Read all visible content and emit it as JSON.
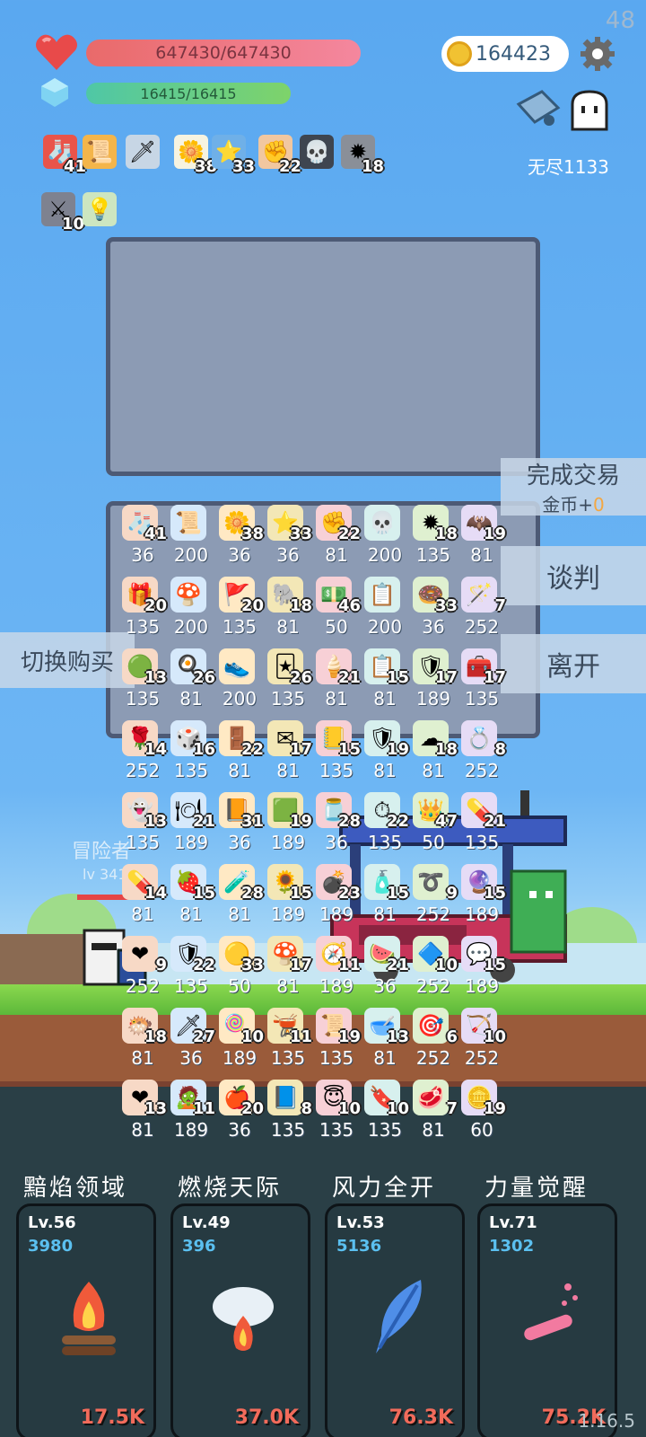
{
  "fps": "48",
  "version": "1.16.5",
  "hud": {
    "hp": "647430/647430",
    "mp": "16415/16415",
    "gold": "164423",
    "endless": "无尽1133"
  },
  "buffs": [
    {
      "icon": "sock-icon",
      "glyph": "🧦",
      "count": "41"
    },
    {
      "icon": "menu-icon",
      "glyph": "📜",
      "count": ""
    },
    {
      "icon": "sword-icon",
      "glyph": "🗡",
      "count": ""
    },
    {
      "icon": "flower-icon",
      "glyph": "🌼",
      "count": "38"
    },
    {
      "icon": "star-card-icon",
      "glyph": "⭐",
      "count": "33"
    },
    {
      "icon": "fist-icon",
      "glyph": "✊",
      "count": "22"
    },
    {
      "icon": "skull-book-icon",
      "glyph": "💀",
      "count": ""
    },
    {
      "icon": "spike-ball-icon",
      "glyph": "✹",
      "count": "18"
    },
    {
      "icon": "sword-card-icon",
      "glyph": "⚔",
      "count": "10"
    },
    {
      "icon": "bulb-card-icon",
      "glyph": "💡",
      "count": ""
    }
  ],
  "buttons": {
    "deal": "完成交易",
    "deal_gold_label": "金币+",
    "deal_gold_value": "0",
    "negotiate": "谈判",
    "leave": "离开",
    "switch": "切换购买"
  },
  "adventurer": {
    "name": "冒险者",
    "level": "lv 341"
  },
  "items": [
    {
      "icon": "sock-icon",
      "glyph": "🧦",
      "count": "41",
      "price": "36"
    },
    {
      "icon": "menu-icon",
      "glyph": "📜",
      "count": "",
      "price": "200"
    },
    {
      "icon": "flower-icon",
      "glyph": "🌼",
      "count": "38",
      "price": "36"
    },
    {
      "icon": "star-card-icon",
      "glyph": "⭐",
      "count": "33",
      "price": "36"
    },
    {
      "icon": "fist-icon",
      "glyph": "✊",
      "count": "22",
      "price": "81"
    },
    {
      "icon": "skull-book-icon",
      "glyph": "💀",
      "count": "",
      "price": "200"
    },
    {
      "icon": "spike-ball-icon",
      "glyph": "✹",
      "count": "18",
      "price": "135"
    },
    {
      "icon": "bat-icon",
      "glyph": "🦇",
      "count": "19",
      "price": "81"
    },
    {
      "icon": "gift-icon",
      "glyph": "🎁",
      "count": "20",
      "price": "135"
    },
    {
      "icon": "mushroom-icon",
      "glyph": "🍄",
      "count": "",
      "price": "200"
    },
    {
      "icon": "flag-icon",
      "glyph": "🚩",
      "count": "20",
      "price": "135"
    },
    {
      "icon": "elephant-icon",
      "glyph": "🐘",
      "count": "18",
      "price": "81"
    },
    {
      "icon": "cash-heart-icon",
      "glyph": "💵",
      "count": "46",
      "price": "50"
    },
    {
      "icon": "list-icon",
      "glyph": "📋",
      "count": "",
      "price": "200"
    },
    {
      "icon": "donut-icon",
      "glyph": "🍩",
      "count": "33",
      "price": "36"
    },
    {
      "icon": "wand-icon",
      "glyph": "🪄",
      "count": "7",
      "price": "252"
    },
    {
      "icon": "leaf-ball-icon",
      "glyph": "🟢",
      "count": "13",
      "price": "135"
    },
    {
      "icon": "egg-icon",
      "glyph": "🍳",
      "count": "26",
      "price": "81"
    },
    {
      "icon": "sneaker-icon",
      "glyph": "👟",
      "count": "",
      "price": "200"
    },
    {
      "icon": "cards-icon",
      "glyph": "🃏",
      "count": "26",
      "price": "135"
    },
    {
      "icon": "ice-cream-icon",
      "glyph": "🍦",
      "count": "21",
      "price": "81"
    },
    {
      "icon": "clipboard-icon",
      "glyph": "📋",
      "count": "15",
      "price": "81"
    },
    {
      "icon": "shield-icon",
      "glyph": "🛡",
      "count": "17",
      "price": "189"
    },
    {
      "icon": "chest-icon",
      "glyph": "🧰",
      "count": "17",
      "price": "135"
    },
    {
      "icon": "rose-icon",
      "glyph": "🌹",
      "count": "14",
      "price": "252"
    },
    {
      "icon": "dice-icon",
      "glyph": "🎲",
      "count": "16",
      "price": "135"
    },
    {
      "icon": "door-icon",
      "glyph": "🚪",
      "count": "22",
      "price": "81"
    },
    {
      "icon": "envelope-icon",
      "glyph": "✉",
      "count": "17",
      "price": "81"
    },
    {
      "icon": "notebook-icon",
      "glyph": "📒",
      "count": "15",
      "price": "135"
    },
    {
      "icon": "shield-blue-icon",
      "glyph": "🛡",
      "count": "19",
      "price": "81"
    },
    {
      "icon": "cloud-icon",
      "glyph": "☁",
      "count": "18",
      "price": "81"
    },
    {
      "icon": "ring-icon",
      "glyph": "💍",
      "count": "8",
      "price": "252"
    },
    {
      "icon": "ghost-icon",
      "glyph": "👻",
      "count": "13",
      "price": "135"
    },
    {
      "icon": "plate-icon",
      "glyph": "🍽",
      "count": "21",
      "price": "189"
    },
    {
      "icon": "book-icon",
      "glyph": "📙",
      "count": "31",
      "price": "36"
    },
    {
      "icon": "slime-icon",
      "glyph": "🟩",
      "count": "19",
      "price": "189"
    },
    {
      "icon": "jar-icon",
      "glyph": "🫙",
      "count": "28",
      "price": "36"
    },
    {
      "icon": "stopwatch-icon",
      "glyph": "⏱",
      "count": "22",
      "price": "135"
    },
    {
      "icon": "crown-icon",
      "glyph": "👑",
      "count": "47",
      "price": "50"
    },
    {
      "icon": "pill-icon",
      "glyph": "💊",
      "count": "21",
      "price": "135"
    },
    {
      "icon": "capsule-icon",
      "glyph": "💊",
      "count": "14",
      "price": "81"
    },
    {
      "icon": "strawberry-icon",
      "glyph": "🍓",
      "count": "15",
      "price": "81"
    },
    {
      "icon": "potion-icon",
      "glyph": "🧪",
      "count": "28",
      "price": "81"
    },
    {
      "icon": "sunflower-icon",
      "glyph": "🌻",
      "count": "15",
      "price": "189"
    },
    {
      "icon": "grenade-icon",
      "glyph": "💣",
      "count": "23",
      "price": "189"
    },
    {
      "icon": "spray-icon",
      "glyph": "🧴",
      "count": "15",
      "price": "81"
    },
    {
      "icon": "noose-icon",
      "glyph": "➰",
      "count": "9",
      "price": "252"
    },
    {
      "icon": "orb-icon",
      "glyph": "🔮",
      "count": "15",
      "price": "189"
    },
    {
      "icon": "heart-gem-icon",
      "glyph": "❤",
      "count": "9",
      "price": "252"
    },
    {
      "icon": "star-shield-icon",
      "glyph": "🛡",
      "count": "22",
      "price": "135"
    },
    {
      "icon": "egg-yolk-icon",
      "glyph": "🟡",
      "count": "33",
      "price": "50"
    },
    {
      "icon": "toadstool-icon",
      "glyph": "🍄",
      "count": "17",
      "price": "81"
    },
    {
      "icon": "compass-icon",
      "glyph": "🧭",
      "count": "11",
      "price": "189"
    },
    {
      "icon": "watermelon-icon",
      "glyph": "🍉",
      "count": "21",
      "price": "36"
    },
    {
      "icon": "hexagon-gem-icon",
      "glyph": "🔷",
      "count": "10",
      "price": "252"
    },
    {
      "icon": "speech-bubble-icon",
      "glyph": "💬",
      "count": "15",
      "price": "189"
    },
    {
      "icon": "bubble-fish-icon",
      "glyph": "🐡",
      "count": "18",
      "price": "81"
    },
    {
      "icon": "dagger-icon",
      "glyph": "🗡",
      "count": "27",
      "price": "36"
    },
    {
      "icon": "lollipop-icon",
      "glyph": "🍭",
      "count": "10",
      "price": "189"
    },
    {
      "icon": "cauldron-icon",
      "glyph": "🫕",
      "count": "11",
      "price": "135"
    },
    {
      "icon": "scroll-icon",
      "glyph": "📜",
      "count": "19",
      "price": "135"
    },
    {
      "icon": "bowl-icon",
      "glyph": "🥣",
      "count": "13",
      "price": "81"
    },
    {
      "icon": "target-icon",
      "glyph": "🎯",
      "count": "6",
      "price": "252"
    },
    {
      "icon": "crossbow-icon",
      "glyph": "🏹",
      "count": "10",
      "price": "252"
    },
    {
      "icon": "big-heart-icon",
      "glyph": "❤",
      "count": "13",
      "price": "81"
    },
    {
      "icon": "zombie-icon",
      "glyph": "🧟",
      "count": "11",
      "price": "189"
    },
    {
      "icon": "apple-icon",
      "glyph": "🍎",
      "count": "20",
      "price": "36"
    },
    {
      "icon": "blue-scroll-icon",
      "glyph": "📘",
      "count": "8",
      "price": "135"
    },
    {
      "icon": "halo-icon",
      "glyph": "😇",
      "count": "10",
      "price": "135"
    },
    {
      "icon": "red-banner-icon",
      "glyph": "🔖",
      "count": "10",
      "price": "135"
    },
    {
      "icon": "meat-icon",
      "glyph": "🥩",
      "count": "7",
      "price": "81"
    },
    {
      "icon": "coin-stack-icon",
      "glyph": "🪙",
      "count": "19",
      "price": "60"
    }
  ],
  "skills": [
    {
      "name": "黯焰领域",
      "level": "Lv.56",
      "power": "3980",
      "cost": "17.5K",
      "icon": "campfire-icon"
    },
    {
      "name": "燃烧天际",
      "level": "Lv.49",
      "power": "396",
      "cost": "37.0K",
      "icon": "fire-cloud-icon"
    },
    {
      "name": "风力全开",
      "level": "Lv.53",
      "power": "5136",
      "cost": "76.3K",
      "icon": "feather-icon"
    },
    {
      "name": "力量觉醒",
      "level": "Lv.71",
      "power": "1302",
      "cost": "75.2K",
      "icon": "test-tube-icon"
    }
  ]
}
